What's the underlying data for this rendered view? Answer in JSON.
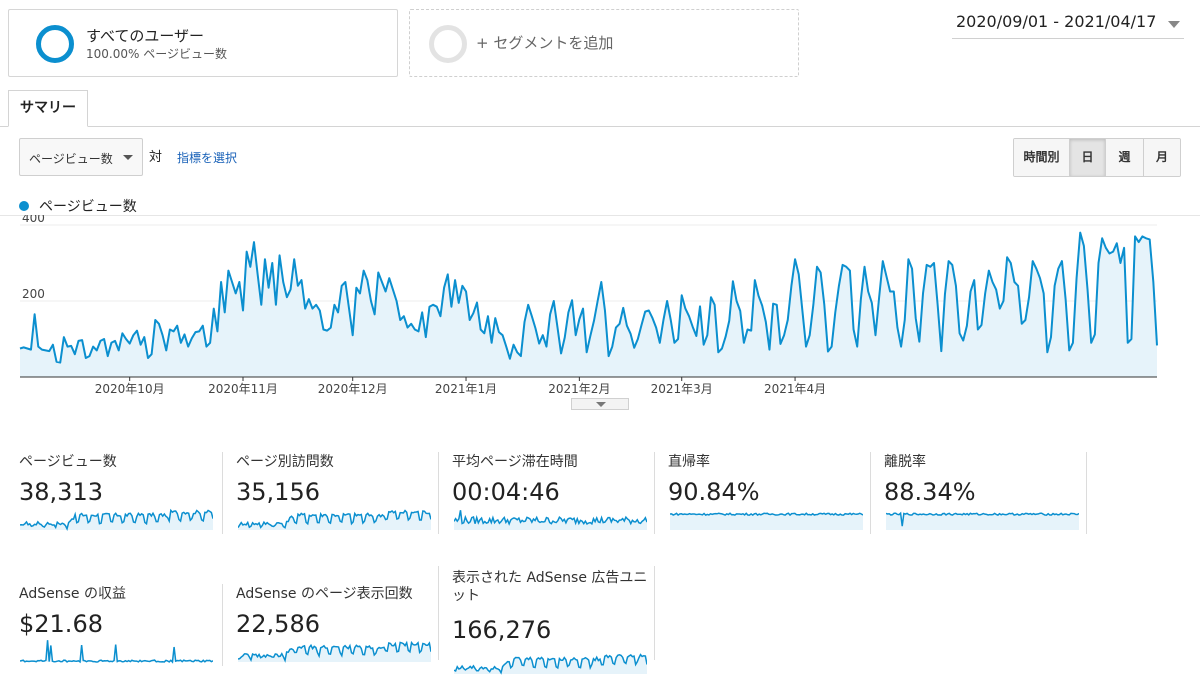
{
  "segments": {
    "active": {
      "title": "すべてのユーザー",
      "subtitle": "100.00% ページビュー数"
    },
    "add": {
      "label": "+ セグメントを追加"
    }
  },
  "date_range": "2020/09/01 - 2021/04/17",
  "tabs": [
    {
      "label": "サマリー"
    }
  ],
  "metric_selector": {
    "selected": "ページビュー数",
    "vs_label": "対",
    "choose_metric": "指標を選択"
  },
  "periods": [
    {
      "label": "時間別",
      "active": false
    },
    {
      "label": "日",
      "active": true
    },
    {
      "label": "週",
      "active": false
    },
    {
      "label": "月",
      "active": false
    }
  ],
  "colors": {
    "accent": "#0b8fcf",
    "fill": "#e6f3fa"
  },
  "chart_data": {
    "type": "area",
    "series": [
      {
        "name": "ページビュー数",
        "values": [
          75,
          78,
          75,
          72,
          165,
          80,
          72,
          70,
          68,
          85,
          40,
          38,
          105,
          80,
          82,
          60,
          95,
          97,
          50,
          55,
          80,
          70,
          95,
          100,
          55,
          90,
          95,
          70,
          115,
          100,
          88,
          110,
          122,
          85,
          105,
          50,
          60,
          150,
          140,
          110,
          70,
          125,
          120,
          135,
          90,
          112,
          80,
          102,
          118,
          120,
          135,
          80,
          90,
          180,
          120,
          250,
          170,
          280,
          250,
          220,
          250,
          175,
          330,
          290,
          355,
          270,
          190,
          310,
          235,
          300,
          190,
          320,
          250,
          210,
          230,
          310,
          240,
          255,
          180,
          205,
          180,
          190,
          175,
          125,
          122,
          130,
          190,
          170,
          240,
          250,
          180,
          110,
          235,
          220,
          280,
          255,
          200,
          165,
          275,
          250,
          225,
          260,
          230,
          200,
          150,
          160,
          130,
          140,
          125,
          120,
          170,
          105,
          185,
          190,
          185,
          160,
          235,
          270,
          185,
          255,
          195,
          240,
          225,
          150,
          168,
          196,
          125,
          115,
          160,
          90,
          155,
          118,
          110,
          80,
          48,
          85,
          65,
          55,
          145,
          190,
          160,
          128,
          88,
          110,
          80,
          165,
          200,
          132,
          62,
          104,
          170,
          202,
          110,
          152,
          180,
          65,
          108,
          148,
          200,
          250,
          175,
          55,
          80,
          130,
          140,
          182,
          135,
          114,
          77,
          100,
          137,
          172,
          175,
          155,
          130,
          90,
          150,
          200,
          150,
          90,
          100,
          215,
          180,
          160,
          132,
          108,
          186,
          85,
          110,
          210,
          190,
          65,
          75,
          106,
          148,
          252,
          200,
          174,
          90,
          125,
          122,
          255,
          214,
          188,
          145,
          72,
          193,
          190,
          87,
          110,
          150,
          240,
          310,
          270,
          175,
          80,
          110,
          190,
          290,
          275,
          190,
          67,
          80,
          170,
          240,
          295,
          290,
          280,
          125,
          80,
          205,
          290,
          225,
          195,
          110,
          210,
          305,
          265,
          225,
          225,
          130,
          80,
          150,
          310,
          285,
          155,
          93,
          220,
          295,
          290,
          300,
          190,
          68,
          218,
          305,
          295,
          240,
          115,
          96,
          135,
          225,
          255,
          125,
          137,
          220,
          280,
          250,
          230,
          180,
          200,
          315,
          300,
          250,
          240,
          140,
          150,
          210,
          305,
          285,
          260,
          220,
          65,
          105,
          240,
          285,
          305,
          205,
          70,
          90,
          260,
          380,
          345,
          230,
          90,
          112,
          300,
          365,
          340,
          325,
          330,
          352,
          300,
          340,
          90,
          100,
          370,
          355,
          370,
          365,
          362,
          250,
          83
        ]
      }
    ],
    "x_ticks": [
      "2020年10月",
      "2020年11月",
      "2020年12月",
      "2021年1月",
      "2021年2月",
      "2021年3月",
      "2021年4月"
    ],
    "y_ticks": [
      400,
      200
    ],
    "ylim": [
      0,
      400
    ],
    "grid": true,
    "legend": "top-left"
  },
  "cards": [
    {
      "label": "ページビュー数",
      "value": "38,313",
      "spark": "pv"
    },
    {
      "label": "ページ別訪問数",
      "value": "35,156",
      "spark": "pv"
    },
    {
      "label": "平均ページ滞在時間",
      "value": "00:04:46",
      "spark": "noisy"
    },
    {
      "label": "直帰率",
      "value": "90.84%",
      "spark": "flat"
    },
    {
      "label": "離脱率",
      "value": "88.34%",
      "spark": "flat_dip"
    },
    {
      "label": "AdSense の収益",
      "value": "$21.68",
      "spark": "spikes"
    },
    {
      "label": "AdSense のページ表示回数",
      "value": "22,586",
      "spark": "pv"
    },
    {
      "label": "表示された AdSense 広告ユニット",
      "value": "166,276",
      "spark": "pv"
    }
  ]
}
